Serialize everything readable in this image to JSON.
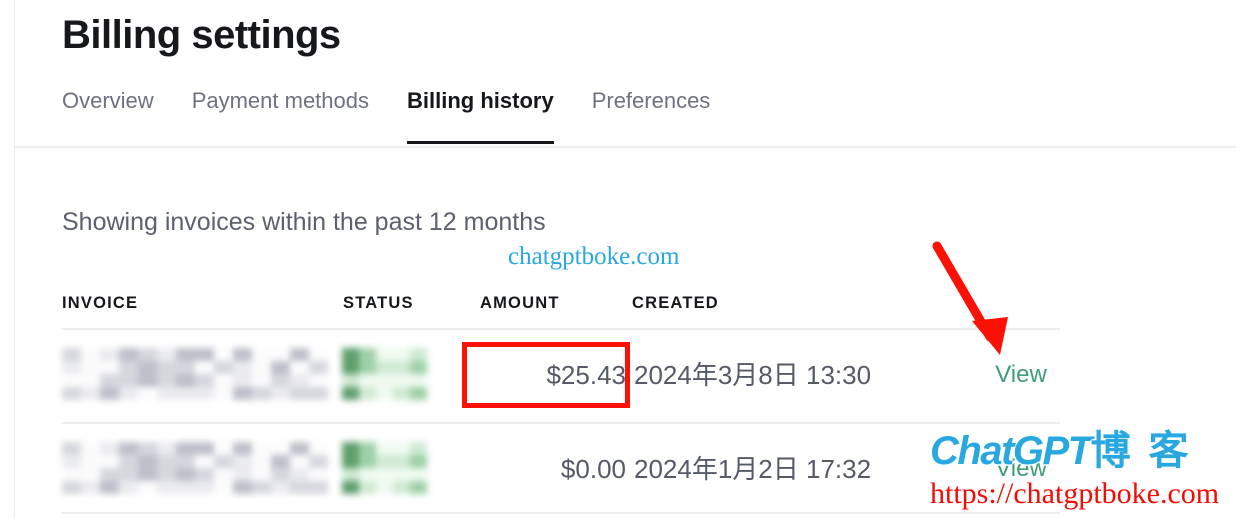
{
  "page": {
    "title": "Billing settings"
  },
  "tabs": [
    {
      "label": "Overview",
      "active": false
    },
    {
      "label": "Payment methods",
      "active": false
    },
    {
      "label": "Billing history",
      "active": true
    },
    {
      "label": "Preferences",
      "active": false
    }
  ],
  "invoices_panel": {
    "showing_text": "Showing invoices within the past 12 months",
    "columns": {
      "invoice": "INVOICE",
      "status": "STATUS",
      "amount": "AMOUNT",
      "created": "CREATED"
    },
    "rows": [
      {
        "invoice": "",
        "status": "",
        "amount": "$25.43",
        "created": "2024年3月8日 13:30",
        "action": "View",
        "highlighted": true
      },
      {
        "invoice": "",
        "status": "",
        "amount": "$0.00",
        "created": "2024年1月2日 17:32",
        "action": "View",
        "highlighted": false
      }
    ]
  },
  "annotations": {
    "red_box_target": "$25.43",
    "arrow_target": "View",
    "arrow_color": "#fc1106",
    "box_color": "#fc1106"
  },
  "watermarks": {
    "small_text": "chatgptboke.com",
    "small_color": "#29a8e0",
    "logo_brand": "ChatGPT",
    "logo_suffix": "博 客",
    "logo_url": "https://chatgptboke.com",
    "logo_color": "#29a8e0",
    "url_color": "#f40b06"
  },
  "colors": {
    "accent_link": "#3f9d77",
    "text_primary": "#16181c",
    "text_muted": "#6e7181",
    "divider": "#ededf0"
  }
}
